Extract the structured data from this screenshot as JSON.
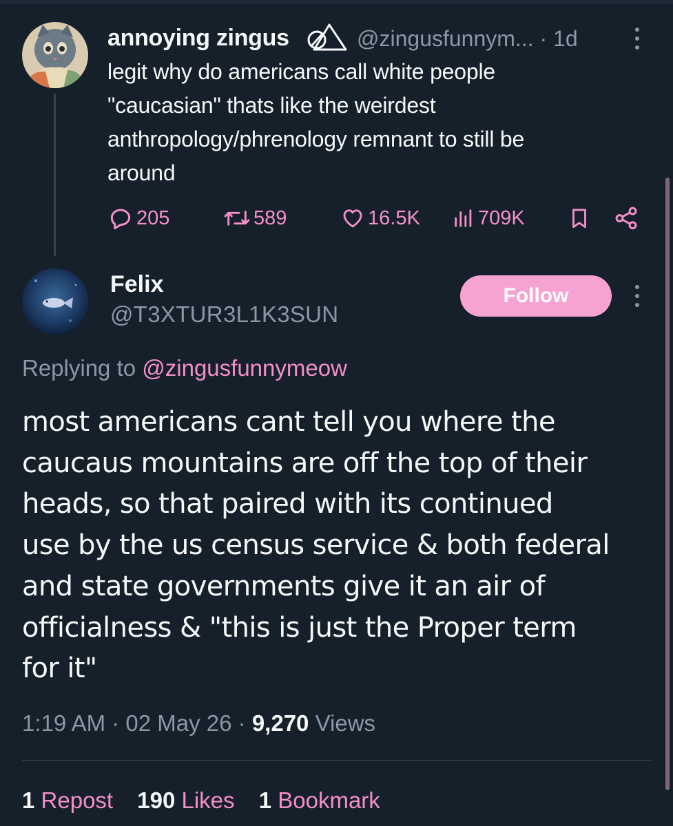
{
  "colors": {
    "background": "#15202b",
    "accent": "#f48fc8",
    "follow_button": "#f6a3d2",
    "secondary_text": "#8b98a5"
  },
  "parent_tweet": {
    "display_name": "annoying zingus",
    "name_icon": "no-symbol-triangle-icon",
    "handle": "@zingusfunnym...",
    "time": "· 1d",
    "lines": [
      "legit why do americans call white people",
      "\"caucasian\" thats like the weirdest",
      "anthropology/phrenology remnant to still be",
      "around"
    ],
    "actions": {
      "replies": "205",
      "reposts": "589",
      "likes": "16.5K",
      "views": "709K"
    }
  },
  "reply_tweet": {
    "display_name": "Felix",
    "handle": "@T3XTUR3L1K3SUN",
    "follow_label": "Follow",
    "replying_prefix": "Replying to ",
    "replying_to": "@zingusfunnymeow",
    "lines": [
      "most americans cant tell you where the",
      "caucaus mountains are off the top of their",
      "heads, so that paired with its continued",
      "use by the us census service & both federal",
      "and state governments give it an air of",
      "officialness & \"this is just the Proper term",
      "for it\""
    ],
    "time": "1:19 AM",
    "date": "02 May 26",
    "views_count": "9,270",
    "views_label": "Views",
    "reposts_count": "1",
    "reposts_label": "Repost",
    "likes_count": "190",
    "likes_label": "Likes",
    "bookmarks_count": "1",
    "bookmarks_label": "Bookmark"
  }
}
